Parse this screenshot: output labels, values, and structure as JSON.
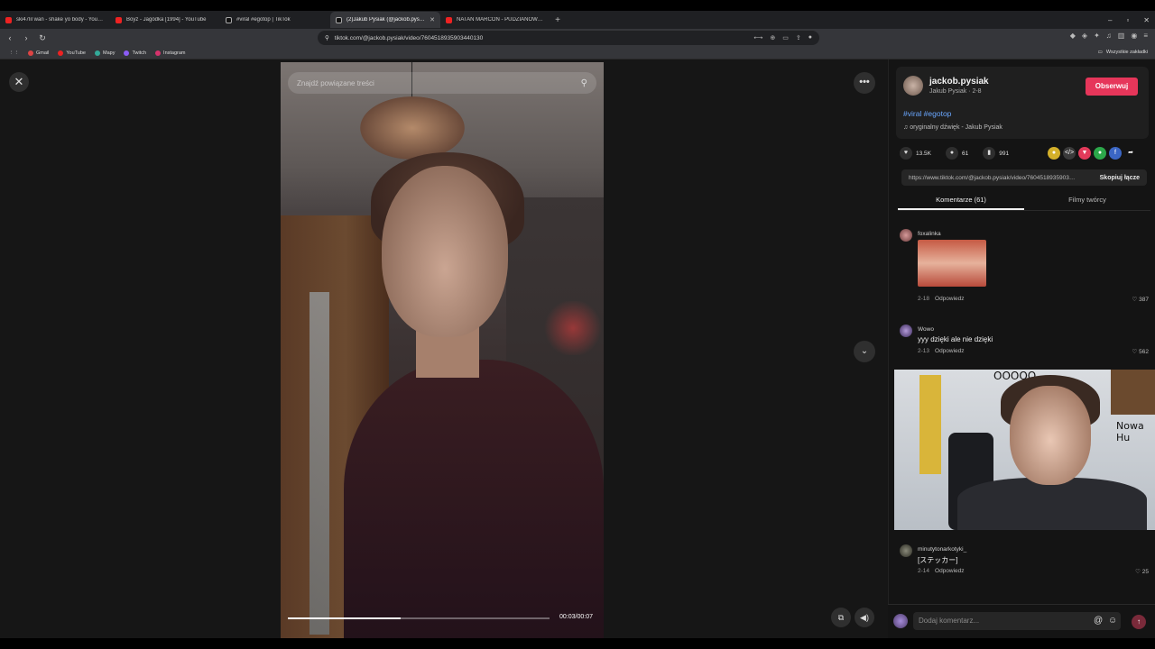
{
  "browser": {
    "tabs": [
      {
        "title": "ski47lil wan - shake yo body - YouTube",
        "icon": "youtube-icon"
      },
      {
        "title": "Boyz - Jagódka [1994] - YouTube",
        "icon": "youtube-icon"
      },
      {
        "title": "#viral #egotop | TikTok",
        "icon": "tiktok-icon"
      },
      {
        "title": "(2)Jakub Pysiak (@jackob.pysiak)",
        "icon": "tiktok-icon",
        "active": true
      },
      {
        "title": "NATAN MARCOŃ - PUDZIANOWSKI",
        "icon": "youtube-icon"
      }
    ],
    "url": "tiktok.com/@jackob.pysiak/video/7604518935903440130",
    "bookmarks": [
      "Gmail",
      "YouTube",
      "Mapy",
      "Twitch",
      "Instagram"
    ],
    "bookmarks_all": "Wszystkie zakładki"
  },
  "video": {
    "search_placeholder": "Znajdź powiązane treści",
    "time": "00:03/00:07",
    "progress": 0.43
  },
  "author": {
    "username": "jackob.pysiak",
    "nickname": "Jakub Pysiak · 2-8",
    "follow_label": "Obserwuj",
    "tags": "#viral #egotop",
    "sound": "oryginalny dźwięk - Jakub Pysiak"
  },
  "stats": {
    "likes": "13.5K",
    "comments": "61",
    "saves": "991"
  },
  "share": {
    "link": "https://www.tiktok.com/@jackob.pysiak/video/7604518935903440130",
    "copy_label": "Skopiuj łącze"
  },
  "tabs": {
    "comments": "Komentarze (61)",
    "creator_videos": "Filmy twórcy"
  },
  "comments": [
    {
      "user": "foxalinka",
      "text": "",
      "date": "2-18",
      "reply": "Odpowiedz",
      "likes": "387",
      "has_sticker": true
    },
    {
      "user": "Wowo",
      "text": "yyy dzięki ale nie dzięki",
      "date": "2-13",
      "reply": "Odpowiedz",
      "likes": "562"
    },
    {
      "user": "minutytonarkotyki_",
      "text": "[ステッカー]",
      "date": "2-14",
      "reply": "Odpowiedz",
      "likes": "25"
    }
  ],
  "webcam_scribble": "OOOOO",
  "webcam_scribble2": "Nowa Hu",
  "add_comment_placeholder": "Dodaj komentarz..."
}
